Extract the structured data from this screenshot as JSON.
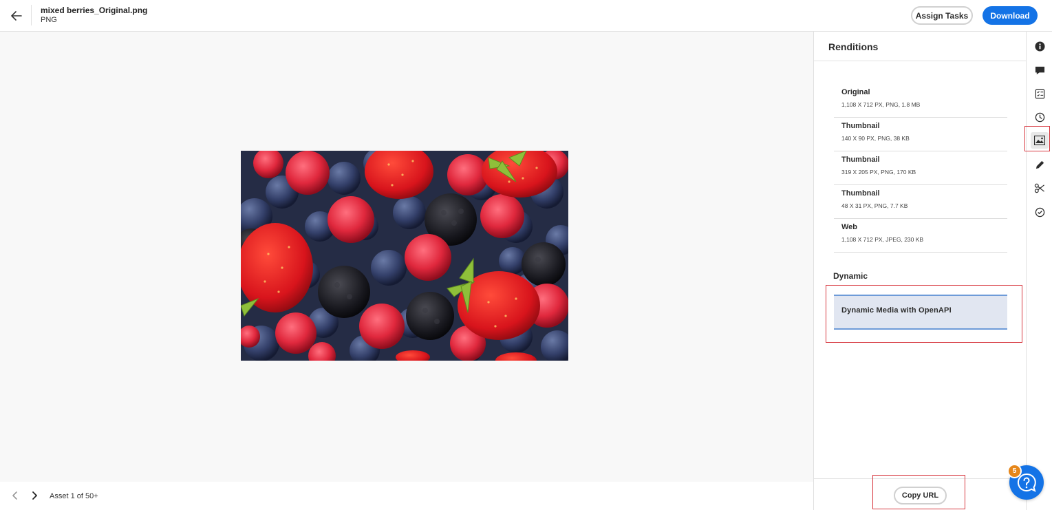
{
  "header": {
    "file_name": "mixed berries_Original.png",
    "file_type": "PNG",
    "assign_tasks_label": "Assign Tasks",
    "download_label": "Download",
    "back_icon": "arrow-left-icon"
  },
  "footer": {
    "asset_position": "Asset 1 of 50+"
  },
  "panel": {
    "title": "Renditions",
    "renditions": [
      {
        "name": "Original",
        "meta": "1,108 X 712 PX, PNG, 1.8 MB"
      },
      {
        "name": "Thumbnail",
        "meta": "140 X 90 PX, PNG, 38 KB"
      },
      {
        "name": "Thumbnail",
        "meta": "319 X 205 PX, PNG, 170 KB"
      },
      {
        "name": "Thumbnail",
        "meta": "48 X 31 PX, PNG, 7.7 KB"
      },
      {
        "name": "Web",
        "meta": "1,108 X 712 PX, JPEG, 230 KB"
      }
    ],
    "dynamic_label": "Dynamic",
    "dynamic_item": "Dynamic Media with OpenAPI",
    "copy_url_label": "Copy URL"
  },
  "rail": {
    "icons": [
      "info-icon",
      "comment-icon",
      "tasks-icon",
      "history-icon",
      "renditions-icon",
      "edit-icon",
      "cut-icon",
      "review-icon"
    ],
    "selected": "renditions-icon"
  },
  "help": {
    "badge_count": "5"
  },
  "colors": {
    "accent": "#1473e6",
    "highlight_box": "#d7373f",
    "selected_rendition_bg": "#e1e6f1",
    "badge": "#e68619"
  }
}
